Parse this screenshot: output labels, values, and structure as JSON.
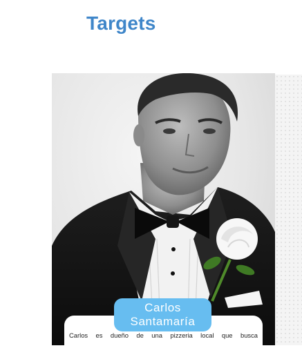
{
  "header": {
    "title": "Targets"
  },
  "persona": {
    "name_first": "Carlos",
    "name_last": "Santamaría",
    "description": "Carlos es dueño de una pizzeria local que busca"
  },
  "colors": {
    "title": "#3f86c9",
    "name_badge": "#67bdf0",
    "card": "#ffffff"
  }
}
